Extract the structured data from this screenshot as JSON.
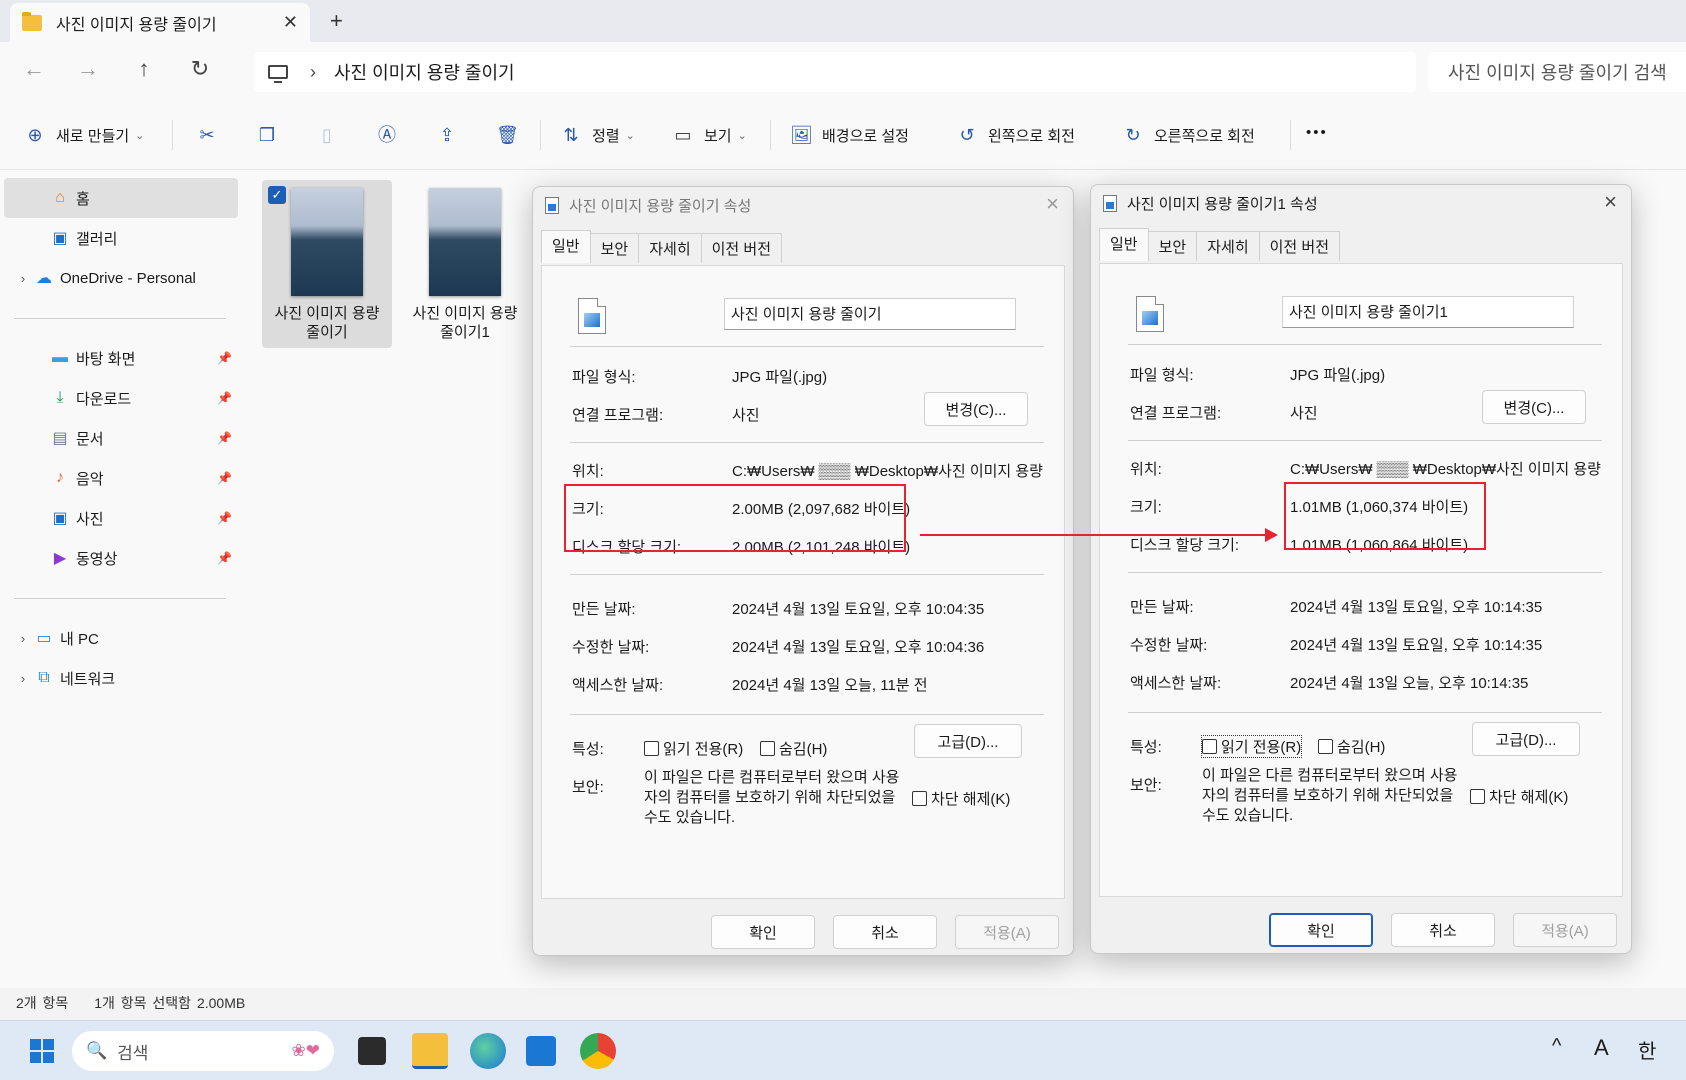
{
  "window": {
    "tab_title": "사진 이미지 용량 줄이기",
    "tab_close": "✕",
    "new_tab": "+"
  },
  "address": {
    "path": "사진 이미지 용량 줄이기",
    "search_placeholder": "사진 이미지 용량 줄이기 검색"
  },
  "toolbar": {
    "new_label": "새로 만들기",
    "sort_label": "정렬",
    "view_label": "보기",
    "set_background": "배경으로 설정",
    "rotate_left": "왼쪽으로 회전",
    "rotate_right": "오른쪽으로 회전",
    "more": "•••"
  },
  "sidebar": {
    "items": [
      {
        "label": "홈"
      },
      {
        "label": "갤러리"
      },
      {
        "label": "OneDrive - Personal"
      },
      {
        "label": "바탕 화면"
      },
      {
        "label": "다운로드"
      },
      {
        "label": "문서"
      },
      {
        "label": "음악"
      },
      {
        "label": "사진"
      },
      {
        "label": "동영상"
      },
      {
        "label": "내 PC"
      },
      {
        "label": "네트워크"
      }
    ]
  },
  "files": [
    {
      "name_line1": "사진 이미지 용량",
      "name_line2": "줄이기"
    },
    {
      "name_line1": "사진 이미지 용량",
      "name_line2": "줄이기1"
    }
  ],
  "status": {
    "count": "2개 항목",
    "selected": "1개 항목 선택함 2.00MB"
  },
  "dialogs": [
    {
      "title": "사진 이미지 용량 줄이기 속성",
      "tabs": [
        "일반",
        "보안",
        "자세히",
        "이전 버전"
      ],
      "filename": "사진 이미지 용량 줄이기",
      "type_label": "파일 형식:",
      "type_value": "JPG 파일(.jpg)",
      "opens_label": "연결 프로그램:",
      "opens_value": "사진",
      "change_btn": "변경(C)...",
      "location_label": "위치:",
      "location_value": "C:₩Users₩ ▒▒▒ ₩Desktop₩사진 이미지 용량",
      "size_label": "크기:",
      "size_value": "2.00MB (2,097,682 바이트)",
      "disk_label": "디스크 할당 크기:",
      "disk_value": "2.00MB (2,101,248 바이트)",
      "created_label": "만든 날짜:",
      "created_value": "2024년 4월 13일 토요일, 오후 10:04:35",
      "modified_label": "수정한 날짜:",
      "modified_value": "2024년 4월 13일 토요일, 오후 10:04:36",
      "accessed_label": "액세스한 날짜:",
      "accessed_value": "2024년 4월 13일 오늘, 11분 전",
      "attr_label": "특성:",
      "readonly": "읽기 전용(R)",
      "hidden": "숨김(H)",
      "advanced_btn": "고급(D)...",
      "security_label": "보안:",
      "security_text": "이 파일은 다른 컴퓨터로부터 왔으며 사용자의 컴퓨터를 보호하기 위해 차단되었을 수도 있습니다.",
      "unblock": "차단 해제(K)",
      "ok": "확인",
      "cancel": "취소",
      "apply": "적용(A)"
    },
    {
      "title": "사진 이미지 용량 줄이기1 속성",
      "tabs": [
        "일반",
        "보안",
        "자세히",
        "이전 버전"
      ],
      "filename": "사진 이미지 용량 줄이기1",
      "type_label": "파일 형식:",
      "type_value": "JPG 파일(.jpg)",
      "opens_label": "연결 프로그램:",
      "opens_value": "사진",
      "change_btn": "변경(C)...",
      "location_label": "위치:",
      "location_value": "C:₩Users₩ ▒▒▒ ₩Desktop₩사진 이미지 용량",
      "size_label": "크기:",
      "size_value": "1.01MB (1,060,374 바이트)",
      "disk_label": "디스크 할당 크기:",
      "disk_value": "1.01MB (1,060,864 바이트)",
      "created_label": "만든 날짜:",
      "created_value": "2024년 4월 13일 토요일, 오후 10:14:35",
      "modified_label": "수정한 날짜:",
      "modified_value": "2024년 4월 13일 토요일, 오후 10:14:35",
      "accessed_label": "액세스한 날짜:",
      "accessed_value": "2024년 4월 13일 오늘, 오후 10:14:35",
      "attr_label": "특성:",
      "readonly": "읽기 전용(R)",
      "hidden": "숨김(H)",
      "advanced_btn": "고급(D)...",
      "security_label": "보안:",
      "security_text": "이 파일은 다른 컴퓨터로부터 왔으며 사용자의 컴퓨터를 보호하기 위해 차단되었을 수도 있습니다.",
      "unblock": "차단 해제(K)",
      "ok": "확인",
      "cancel": "취소",
      "apply": "적용(A)"
    }
  ],
  "taskbar": {
    "search": "검색",
    "tray_lang1": "A",
    "tray_lang2": "한"
  },
  "colors": {
    "highlight_red": "#e8222e",
    "accent_blue": "#1a5fb4"
  }
}
